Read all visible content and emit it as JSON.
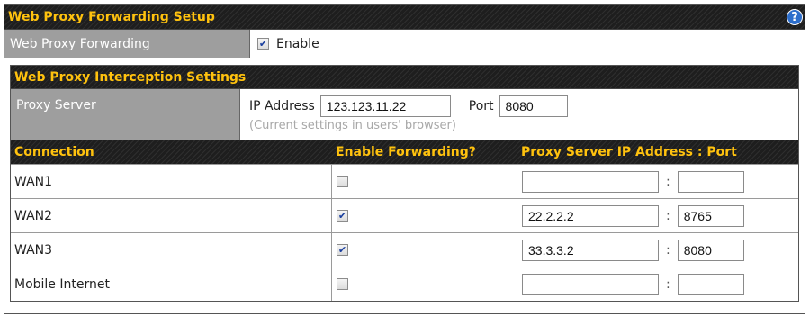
{
  "title": "Web Proxy Forwarding Setup",
  "forwarding": {
    "label": "Web Proxy Forwarding",
    "checkbox_label": "Enable",
    "checked": true
  },
  "interception": {
    "title": "Web Proxy Interception Settings",
    "proxy_server_label": "Proxy Server",
    "ip_label": "IP Address",
    "ip_value": "123.123.11.22",
    "port_label": "Port",
    "port_value": "8080",
    "hint": "(Current settings in users' browser)"
  },
  "table": {
    "headers": [
      "Connection",
      "Enable Forwarding?",
      "Proxy Server IP Address : Port"
    ],
    "separator": ":",
    "rows": [
      {
        "connection": "WAN1",
        "enabled": false,
        "ip": "",
        "port": ""
      },
      {
        "connection": "WAN2",
        "enabled": true,
        "ip": "22.2.2.2",
        "port": "8765"
      },
      {
        "connection": "WAN3",
        "enabled": true,
        "ip": "33.3.3.2",
        "port": "8080"
      },
      {
        "connection": "Mobile Internet",
        "enabled": false,
        "ip": "",
        "port": ""
      }
    ]
  },
  "icons": {
    "help": "help-icon",
    "check": "check-icon"
  },
  "colors": {
    "header_bg": "#1e1e1e",
    "header_text": "#ffc20e",
    "label_bg": "#9e9e9e",
    "hint_text": "#a8a8a8",
    "help_icon": "#2d6ecb"
  }
}
